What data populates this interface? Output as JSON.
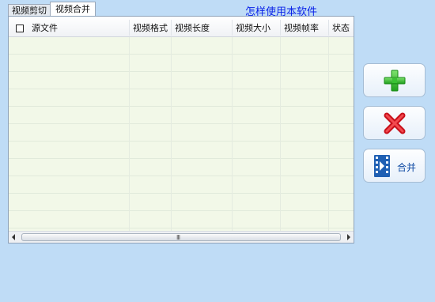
{
  "tabs": [
    "视频剪切",
    "视频合并"
  ],
  "active_tab": "视频合并",
  "help_link": "怎样使用本软件",
  "table": {
    "columns": [
      "源文件",
      "视频格式",
      "视频长度",
      "视频大小",
      "视频帧率",
      "状态"
    ],
    "rows": []
  },
  "scrollbar": {
    "grip": "III"
  },
  "buttons": {
    "add_icon": "plus-icon",
    "remove_icon": "x-icon",
    "merge_label": "合并",
    "merge_icon": "film-play-icon"
  },
  "colors": {
    "background": "#bfdcf6",
    "link": "#0a22e8",
    "grid_body": "#f2f8e8",
    "add_green": "#2fbf2a",
    "remove_red": "#e0151a",
    "merge_blue": "#0f4aa3"
  }
}
